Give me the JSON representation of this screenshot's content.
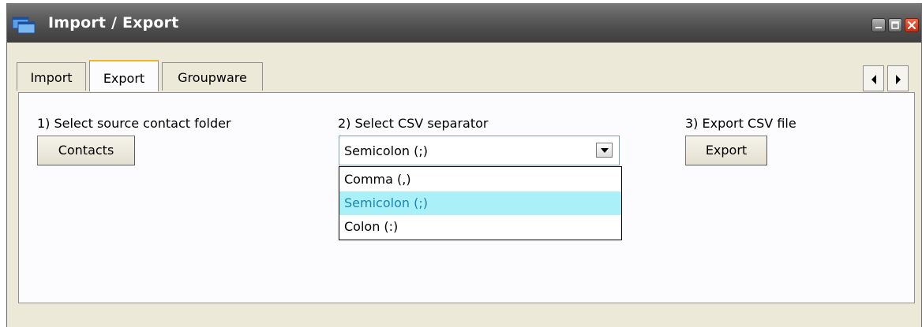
{
  "window": {
    "title": "Import / Export",
    "controls": {
      "minimize_icon": "minimize-icon",
      "maximize_icon": "maximize-icon",
      "close_icon": "close-icon"
    }
  },
  "tabs": [
    {
      "label": "Import",
      "active": false
    },
    {
      "label": "Export",
      "active": true
    },
    {
      "label": "Groupware",
      "active": false
    }
  ],
  "tab_nav": {
    "prev_icon": "triangle-left-icon",
    "next_icon": "triangle-right-icon"
  },
  "export_panel": {
    "step1": {
      "label": "1) Select source contact folder",
      "button_label": "Contacts"
    },
    "step2": {
      "label": "2) Select CSV separator",
      "selected_value": "Semicolon (;)",
      "options": [
        "Comma (,)",
        "Semicolon (;)",
        "Colon (:)"
      ],
      "highlighted_option": "Semicolon (;)"
    },
    "step3": {
      "label": "3) Export CSV file",
      "button_label": "Export"
    }
  },
  "colors": {
    "titlebar": "#4a4a4a",
    "window_bg": "#ece9d8",
    "panel_bg": "#fcfcfe",
    "active_tab_accent": "#f0b42a",
    "option_highlight_bg": "#aaf0f8",
    "option_highlight_text": "#1a86b0",
    "close_button": "#d9371a"
  }
}
